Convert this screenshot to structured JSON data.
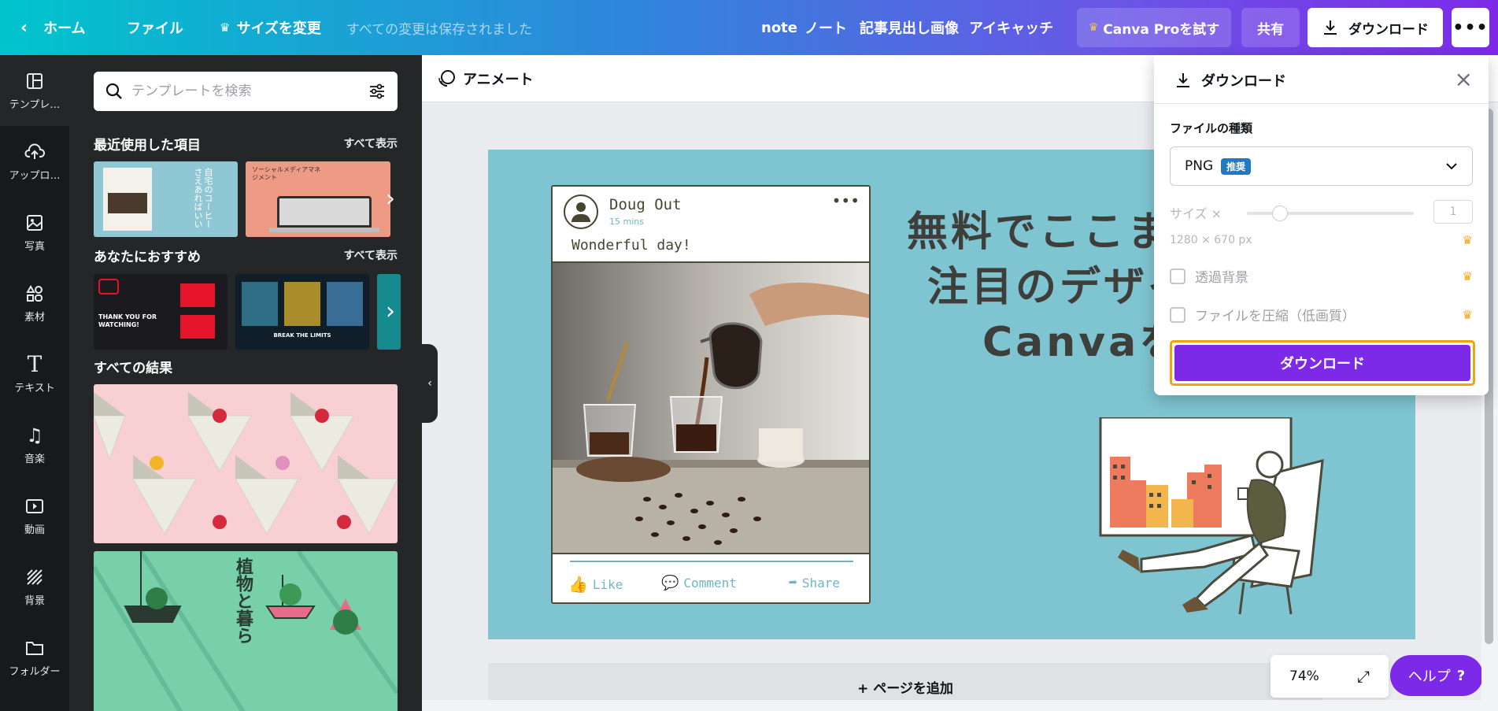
{
  "topbar": {
    "home": "ホーム",
    "file": "ファイル",
    "resize": "サイズを変更",
    "saved_status": "すべての変更は保存されました",
    "doc_tags": [
      "note",
      "ノート",
      "記事見出し画像",
      "アイキャッチ"
    ],
    "try_pro": "Canva Proを試す",
    "share": "共有",
    "download": "ダウンロード"
  },
  "rail": [
    {
      "label": "テンプレ…",
      "icon": "template-icon"
    },
    {
      "label": "アップロ…",
      "icon": "upload-icon"
    },
    {
      "label": "写真",
      "icon": "photo-icon"
    },
    {
      "label": "素材",
      "icon": "elements-icon"
    },
    {
      "label": "テキスト",
      "icon": "text-icon"
    },
    {
      "label": "音楽",
      "icon": "music-icon"
    },
    {
      "label": "動画",
      "icon": "video-icon"
    },
    {
      "label": "背景",
      "icon": "background-icon"
    },
    {
      "label": "フォルダー",
      "icon": "folder-icon"
    }
  ],
  "panel": {
    "search_placeholder": "テンプレートを検索",
    "recent_title": "最近使用した項目",
    "recommended_title": "あなたにおすすめ",
    "results_title": "すべての結果",
    "see_all": "すべて表示",
    "recent_thumbs": [
      {
        "text": "自宅のコーヒーさえあればいい"
      },
      {
        "text": "ソーシャルメディアマネジメント"
      }
    ],
    "recommended_thumbs": [
      {
        "text": "THANK YOU FOR WATCHING!"
      },
      {
        "text": "BREAK THE LIMITS"
      }
    ],
    "result_thumbs": [
      {
        "text": ""
      },
      {
        "text": "植物と暮ら"
      }
    ]
  },
  "editor": {
    "animate": "アニメート",
    "add_page": "+ ページを追加",
    "zoom": "74%",
    "help": "ヘルプ"
  },
  "design": {
    "post": {
      "name": "Doug Out",
      "time": "15 mins",
      "caption": "Wonderful day!",
      "actions": [
        "Like",
        "Comment",
        "Share"
      ]
    },
    "headline": [
      "無料でここま",
      "注目のデザイ",
      "Canvaを"
    ]
  },
  "download_panel": {
    "title": "ダウンロード",
    "file_type_label": "ファイルの種類",
    "file_type_value": "PNG",
    "recommended_badge": "推奨",
    "size_label": "サイズ ×",
    "size_value": "1",
    "dimensions": "1280 × 670 px",
    "transparent_bg": "透過背景",
    "compress": "ファイルを圧縮（低画質）",
    "download_button": "ダウンロード"
  },
  "colors": {
    "accent": "#7d2ae8",
    "canvas_bg": "#7ec5d1",
    "highlight": "#f1a30f",
    "crown": "#f4a51c"
  }
}
